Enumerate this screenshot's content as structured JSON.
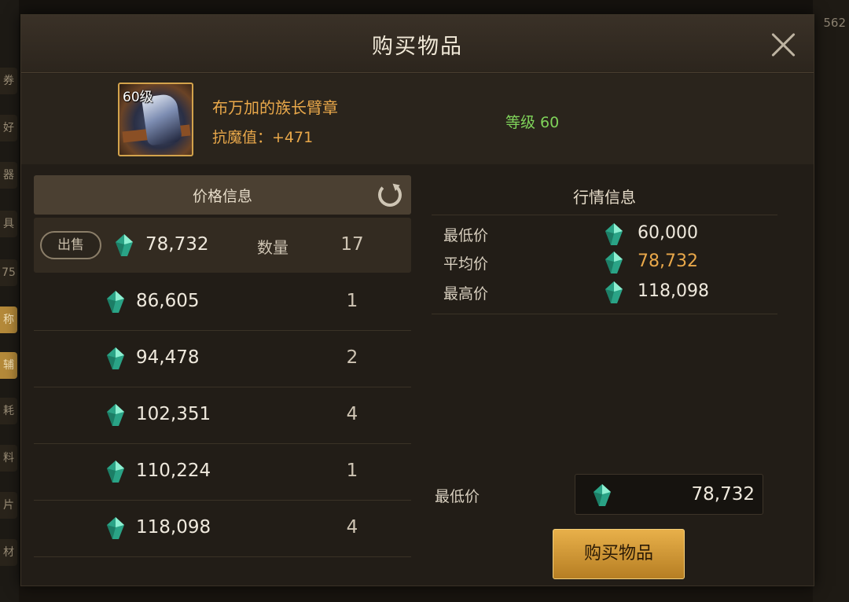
{
  "dialog": {
    "title": "购买物品"
  },
  "item": {
    "level_badge": "60级",
    "name": "布万加的族长臂章",
    "stat": "抗魔值：+471",
    "level_text": "等级 60"
  },
  "price_info": {
    "header": "价格信息",
    "sell_label": "出售",
    "quantity_label": "数量",
    "rows": [
      {
        "price": "78,732",
        "qty": "17"
      },
      {
        "price": "86,605",
        "qty": "1"
      },
      {
        "price": "94,478",
        "qty": "2"
      },
      {
        "price": "102,351",
        "qty": "4"
      },
      {
        "price": "110,224",
        "qty": "1"
      },
      {
        "price": "118,098",
        "qty": "4"
      }
    ]
  },
  "market_info": {
    "header": "行情信息",
    "min_label": "最低价",
    "min_value": "60,000",
    "avg_label": "平均价",
    "avg_value": "78,732",
    "max_label": "最高价",
    "max_value": "118,098"
  },
  "purchase": {
    "min_price_label": "最低价",
    "price_value": "78,732",
    "buy_label": "购买物品"
  },
  "background": {
    "left_tabs": [
      "券",
      "好",
      "器",
      "具",
      "75",
      "称",
      "辅",
      "耗",
      "料",
      "片",
      "材"
    ],
    "top_right_number": "562"
  },
  "colors": {
    "accent_gold": "#e9a84a",
    "level_green": "#7fd35a",
    "gem": "#3fc7a4"
  },
  "icons": {
    "close": "close-icon",
    "refresh": "refresh-icon",
    "currency": "gem-icon"
  }
}
